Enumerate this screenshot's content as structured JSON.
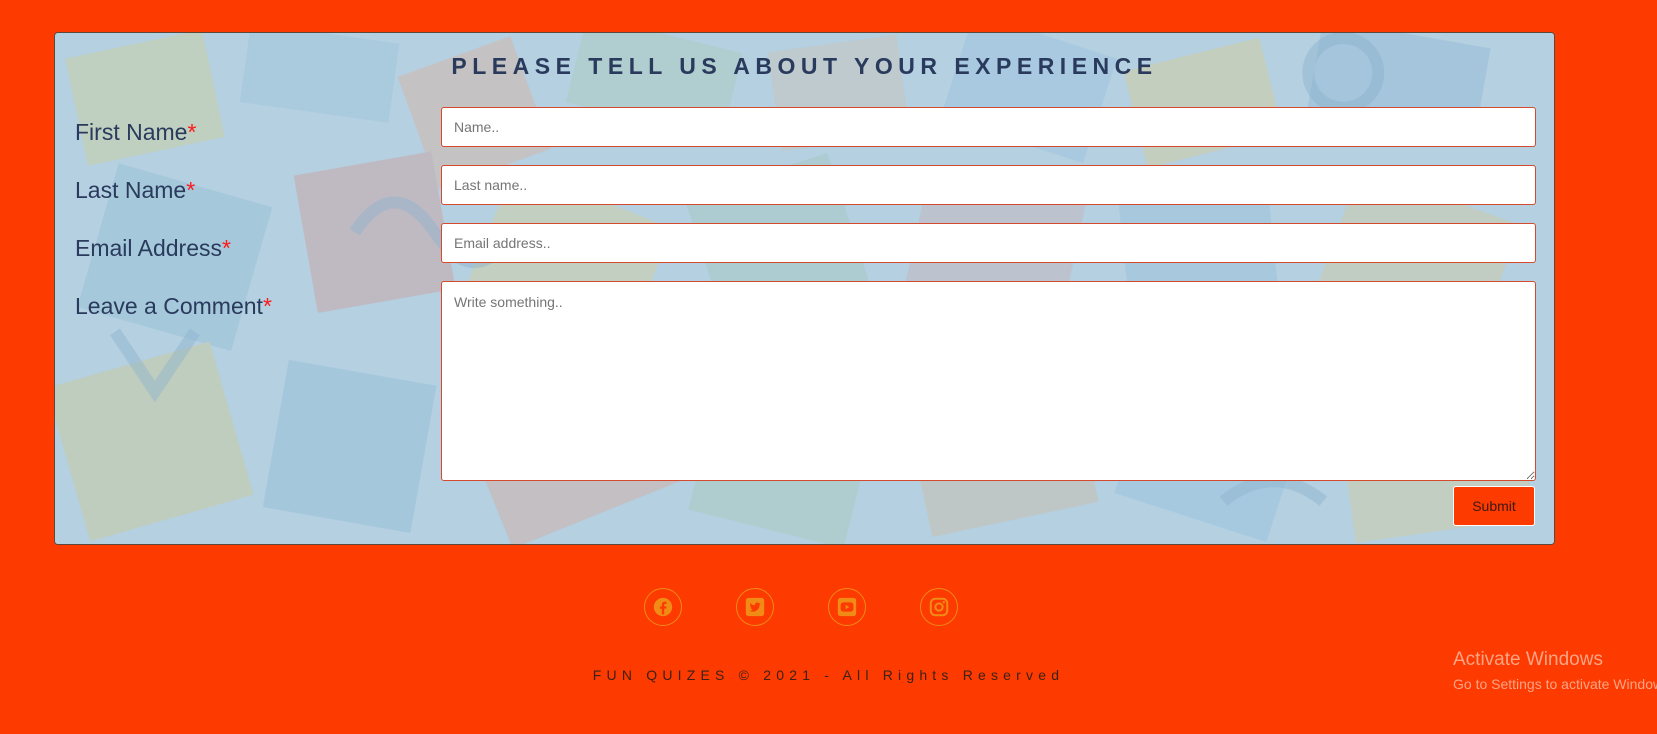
{
  "form": {
    "title": "PLEASE TELL US ABOUT YOUR EXPERIENCE",
    "required_mark": "*",
    "first_name": {
      "label": "First Name",
      "placeholder": "Name..",
      "value": ""
    },
    "last_name": {
      "label": "Last Name",
      "placeholder": "Last name..",
      "value": ""
    },
    "email": {
      "label": "Email Address",
      "placeholder": "Email address..",
      "value": ""
    },
    "comment": {
      "label": "Leave a Comment",
      "placeholder": "Write something..",
      "value": ""
    },
    "submit_label": "Submit"
  },
  "footer": {
    "social_icons": [
      "facebook-icon",
      "twitter-icon",
      "youtube-icon",
      "instagram-icon"
    ],
    "copyright": "FUN QUIZES © 2021 - All Rights Reserved"
  },
  "watermark": {
    "title": "Activate Windows",
    "subtitle": "Go to Settings to activate Windows."
  },
  "colors": {
    "page_background": "#fd3a00",
    "title_text": "#2a3a5c",
    "required_mark": "#ff1a1a",
    "field_border": "#d34a2c",
    "social_icon": "#f08b16"
  }
}
